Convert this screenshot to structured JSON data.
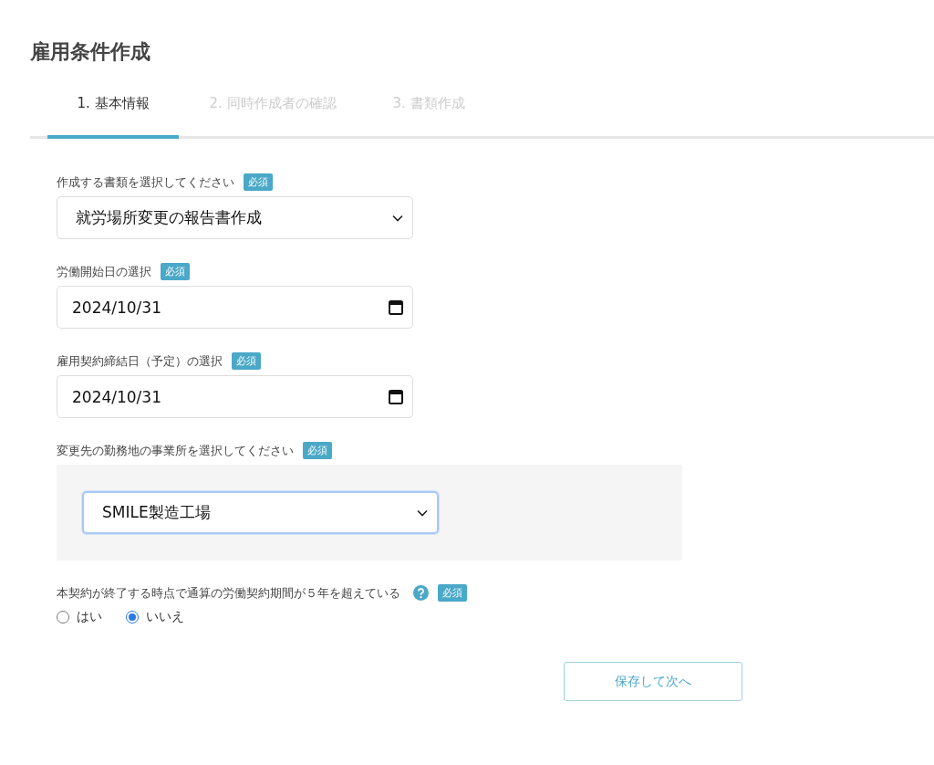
{
  "page_title": "雇用条件作成",
  "steps": [
    {
      "label": "1. 基本情報",
      "selected": true
    },
    {
      "label": "2. 同時作成者の確認",
      "selected": false
    },
    {
      "label": "3. 書類作成",
      "selected": false
    }
  ],
  "fields": [
    {
      "kind": "select",
      "label": "作成する書類を選択してください",
      "badge": "必須",
      "value": "就労場所変更の報告書作成",
      "panel": false,
      "focused": false
    },
    {
      "kind": "date",
      "label": "労働開始日の選択",
      "badge": "必須",
      "value": "2024/10/31"
    },
    {
      "kind": "date",
      "label": "雇用契約締結日（予定）の選択",
      "badge": "必須",
      "value": "2024/10/31"
    },
    {
      "kind": "select",
      "label": "変更先の勤務地の事業所を選択してください",
      "badge": "必須",
      "value": "SMILE製造工場",
      "panel": true,
      "focused": true
    },
    {
      "kind": "radio",
      "label": "本契約が終了する時点で通算の労働契約期間が５年を超えている",
      "help": true,
      "badge": "必須",
      "options": [
        {
          "label": "はい",
          "selected": false
        },
        {
          "label": "いいえ",
          "selected": true
        }
      ]
    }
  ],
  "save_button": "保存して次へ"
}
